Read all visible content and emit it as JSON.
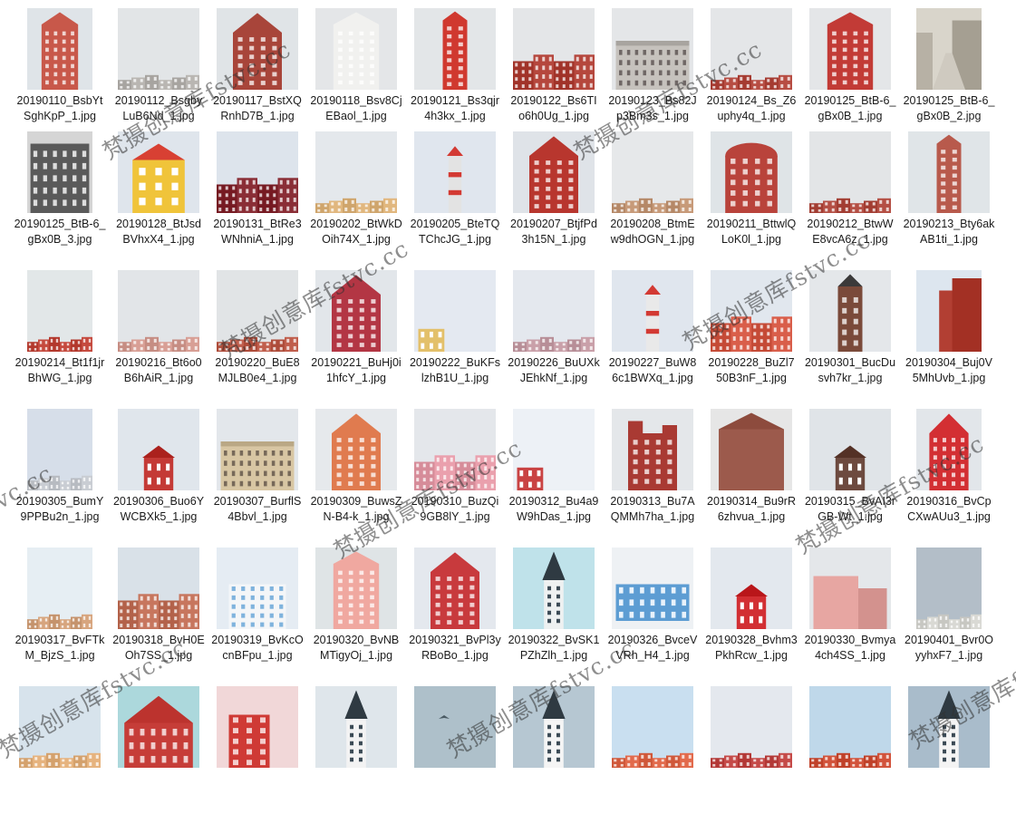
{
  "files": [
    {
      "name": "20190110_BsbYtSghKpP_1.jpg",
      "img": {
        "bg": "#dfe4e8",
        "kind": "tower",
        "color": "#c8584a"
      }
    },
    {
      "name": "20190112_BsgbyLuB6Nd_1.jpg",
      "img": {
        "bg": "#e2e5e7",
        "kind": "row-low",
        "color": "#b9b6b2"
      }
    },
    {
      "name": "20190117_BstXQRnhD7B_1.jpg",
      "img": {
        "bg": "#e0e4e7",
        "kind": "gable",
        "color": "#a8453a"
      }
    },
    {
      "name": "20190118_Bsv8CjEBaol_1.jpg",
      "img": {
        "bg": "#e4e6e8",
        "kind": "tower",
        "color": "#f1f1ef"
      }
    },
    {
      "name": "20190121_Bs3qjr4h3kx_1.jpg",
      "img": {
        "bg": "#e3e6e8",
        "kind": "slim",
        "color": "#d0392f"
      }
    },
    {
      "name": "20190122_Bs6TIo6h0Ug_1.jpg",
      "img": {
        "bg": "#e4e6e8",
        "kind": "row-mid",
        "color": "#b5473d"
      }
    },
    {
      "name": "20190123_Bs82Jp3Bm3s_1.jpg",
      "img": {
        "bg": "#e4e6e8",
        "kind": "wide",
        "color": "#c6c2bd"
      }
    },
    {
      "name": "20190124_Bs_Z6uphy4q_1.jpg",
      "img": {
        "bg": "#e4e6e8",
        "kind": "row-low",
        "color": "#b74d43"
      }
    },
    {
      "name": "20190125_BtB-6_gBx0B_1.jpg",
      "img": {
        "bg": "#e4e6e8",
        "kind": "tower",
        "color": "#c23b36"
      }
    },
    {
      "name": "20190125_BtB-6_gBx0B_2.jpg",
      "img": {
        "bg": "#d9d5cb",
        "kind": "photo",
        "color": "#8a857b"
      }
    },
    {
      "name": "20190125_BtB-6_gBx0B_3.jpg",
      "img": {
        "bg": "#bcbcbc",
        "kind": "photo-bw",
        "color": "#444444"
      }
    },
    {
      "name": "20190128_BtJsdBVhxX4_1.jpg",
      "img": {
        "bg": "#dfe5ec",
        "kind": "yellow",
        "color": "#f0c43a"
      }
    },
    {
      "name": "20190131_BtRe3WNhniA_1.jpg",
      "img": {
        "bg": "#dde4ec",
        "kind": "row-mid",
        "color": "#8a2e36"
      }
    },
    {
      "name": "20190202_BtWkDOih74X_1.jpg",
      "img": {
        "bg": "#e4e8ec",
        "kind": "row-low",
        "color": "#e1b77e"
      }
    },
    {
      "name": "20190205_BteTQTChcJG_1.jpg",
      "img": {
        "bg": "#e0e6ee",
        "kind": "lighthouse",
        "color": "#e3e3e3"
      }
    },
    {
      "name": "20190207_BtjfPd3h15N_1.jpg",
      "img": {
        "bg": "#dfe3e8",
        "kind": "gable",
        "color": "#b8362e"
      }
    },
    {
      "name": "20190208_BtmEw9dhOGN_1.jpg",
      "img": {
        "bg": "#e6e8ea",
        "kind": "row-low",
        "color": "#c79a79"
      }
    },
    {
      "name": "20190211_BttwlQLoK0l_1.jpg",
      "img": {
        "bg": "#dfe4e7",
        "kind": "dome",
        "color": "#b9433b"
      }
    },
    {
      "name": "20190212_BtwWE8vcA6z_1.jpg",
      "img": {
        "bg": "#e3e5e7",
        "kind": "row-low",
        "color": "#b44f44"
      }
    },
    {
      "name": "20190213_Bty6akAB1ti_1.jpg",
      "img": {
        "bg": "#e0e5e8",
        "kind": "slim",
        "color": "#b85a4c"
      }
    },
    {
      "name": "20190214_Bt1f1jrBhWG_1.jpg",
      "img": {
        "bg": "#e2e7e8",
        "kind": "row-low",
        "color": "#c54a3e"
      }
    },
    {
      "name": "20190216_Bt6o0B6hAiR_1.jpg",
      "img": {
        "bg": "#e2e5e8",
        "kind": "row-low",
        "color": "#d89f95"
      }
    },
    {
      "name": "20190220_BuE8MJLB0e4_1.jpg",
      "img": {
        "bg": "#e1e4e6",
        "kind": "row-low",
        "color": "#c05e4c"
      }
    },
    {
      "name": "20190221_BuHj0i1hfcY_1.jpg",
      "img": {
        "bg": "#e2e6ea",
        "kind": "gable",
        "color": "#b33644"
      }
    },
    {
      "name": "20190222_BuKFslzhB1U_1.jpg",
      "img": {
        "bg": "#e4e9f1",
        "kind": "corner",
        "color": "#e3c06a"
      }
    },
    {
      "name": "20190226_BuUXkJEhkNf_1.jpg",
      "img": {
        "bg": "#e4e8ee",
        "kind": "row-low",
        "color": "#c9a0a9"
      }
    },
    {
      "name": "20190227_BuW86c1BWXq_1.jpg",
      "img": {
        "bg": "#e0e6ee",
        "kind": "lighthouse",
        "color": "#e9e9e9"
      }
    },
    {
      "name": "20190228_BuZl750B3nF_1.jpg",
      "img": {
        "bg": "#e1e7ee",
        "kind": "row-mid",
        "color": "#d95e4a"
      }
    },
    {
      "name": "20190301_BucDusvh7kr_1.jpg",
      "img": {
        "bg": "#e4e7ea",
        "kind": "clock",
        "color": "#7a4a3a"
      }
    },
    {
      "name": "20190304_Buj0V5MhUvb_1.jpg",
      "img": {
        "bg": "#dde6ef",
        "kind": "block",
        "color": "#b23f33"
      }
    },
    {
      "name": "20190305_BumY9PPBu2n_1.jpg",
      "img": {
        "bg": "#d6dee9",
        "kind": "row-low",
        "color": "#c9cdd3"
      }
    },
    {
      "name": "20190306_Buo6YWCBXk5_1.jpg",
      "img": {
        "bg": "#e0e6ec",
        "kind": "house",
        "color": "#c43a36"
      }
    },
    {
      "name": "20190307_BurflS4Bbvl_1.jpg",
      "img": {
        "bg": "#e3e7eb",
        "kind": "wide",
        "color": "#d8c6a3"
      }
    },
    {
      "name": "20190309_BuwsZN-B4-k_1.jpg",
      "img": {
        "bg": "#e6e9ec",
        "kind": "gable",
        "color": "#e07b4f"
      }
    },
    {
      "name": "20190310_BuzQi9GB8lY_1.jpg",
      "img": {
        "bg": "#e4e7eb",
        "kind": "row-mid",
        "color": "#eaa0ad"
      }
    },
    {
      "name": "20190312_Bu4a9W9hDas_1.jpg",
      "img": {
        "bg": "#edf1f6",
        "kind": "corner",
        "color": "#c94343"
      }
    },
    {
      "name": "20190313_Bu7AQMMh7ha_1.jpg",
      "img": {
        "bg": "#e4e7ea",
        "kind": "castle",
        "color": "#a93a33"
      }
    },
    {
      "name": "20190314_Bu9rR6zhvua_1.jpg",
      "img": {
        "bg": "#e6e6e6",
        "kind": "brick",
        "color": "#9c5a4c"
      }
    },
    {
      "name": "20190315_BvAI3rGB-Wt_1.jpg",
      "img": {
        "bg": "#e0e4e8",
        "kind": "house",
        "color": "#6d4a3f"
      }
    },
    {
      "name": "20190316_BvCpCXwAUu3_1.jpg",
      "img": {
        "bg": "#e2e6ea",
        "kind": "gable",
        "color": "#d32f33"
      }
    },
    {
      "name": "20190317_BvFTkM_BjzS_1.jpg",
      "img": {
        "bg": "#e6eef3",
        "kind": "row-low",
        "color": "#d7a57e"
      }
    },
    {
      "name": "20190318_BvH0EOh7SS_1.jpg",
      "img": {
        "bg": "#d9e1e8",
        "kind": "row-mid",
        "color": "#c7765e"
      }
    },
    {
      "name": "20190319_BvKcOcnBFpu_1.jpg",
      "img": {
        "bg": "#e5ecf3",
        "kind": "modern",
        "color": "#f4f6f8"
      }
    },
    {
      "name": "20190320_BvNBMTigyOj_1.jpg",
      "img": {
        "bg": "#dfe4e6",
        "kind": "tower",
        "color": "#f0a8a0"
      }
    },
    {
      "name": "20190321_BvPl3yRBoBo_1.jpg",
      "img": {
        "bg": "#e4e8ee",
        "kind": "gable",
        "color": "#c83a3d"
      }
    },
    {
      "name": "20190322_BvSK1PZhZlh_1.jpg",
      "img": {
        "bg": "#bfe2ea",
        "kind": "spire",
        "color": "#eef1f1"
      }
    },
    {
      "name": "20190326_BvceVVRh_H4_1.jpg",
      "img": {
        "bg": "#eef1f4",
        "kind": "blue-block",
        "color": "#5d9dd3"
      }
    },
    {
      "name": "20190328_Bvhm3PkhRcw_1.jpg",
      "img": {
        "bg": "#e3e8ee",
        "kind": "house",
        "color": "#d22f33"
      }
    },
    {
      "name": "20190330_Bvmya4ch4SS_1.jpg",
      "img": {
        "bg": "#e4e7ea",
        "kind": "pink",
        "color": "#e7a6a2"
      }
    },
    {
      "name": "20190401_Bvr0OyyhxF7_1.jpg",
      "img": {
        "bg": "#b3bec8",
        "kind": "row-low",
        "color": "#d9d9d4"
      }
    },
    {
      "name": "",
      "img": {
        "bg": "#d7e3ec",
        "kind": "row-low",
        "color": "#e6b37e"
      }
    },
    {
      "name": "",
      "img": {
        "bg": "#acd8dc",
        "kind": "barn",
        "color": "#c63d38"
      }
    },
    {
      "name": "",
      "img": {
        "bg": "#f1d7d8",
        "kind": "balcony",
        "color": "#cf3a35"
      }
    },
    {
      "name": "",
      "img": {
        "bg": "#dfe6eb",
        "kind": "spire",
        "color": "#f3f3f3"
      }
    },
    {
      "name": "",
      "img": {
        "bg": "#aec0ca",
        "kind": "sky",
        "color": "#4a5a63"
      }
    },
    {
      "name": "",
      "img": {
        "bg": "#b6c7d2",
        "kind": "spire",
        "color": "#f5f5f5"
      }
    },
    {
      "name": "",
      "img": {
        "bg": "#c9dff0",
        "kind": "row-low",
        "color": "#e26a4c"
      }
    },
    {
      "name": "",
      "img": {
        "bg": "#e4e8ee",
        "kind": "row-low",
        "color": "#c54a48"
      }
    },
    {
      "name": "",
      "img": {
        "bg": "#bfd8ea",
        "kind": "row-low",
        "color": "#d2533b"
      }
    },
    {
      "name": "",
      "img": {
        "bg": "#a9bccb",
        "kind": "spire",
        "color": "#f4f4f4"
      }
    }
  ],
  "watermark": "梵摄创意库fstvc.cc",
  "watermark_fragment": "vc.cc"
}
